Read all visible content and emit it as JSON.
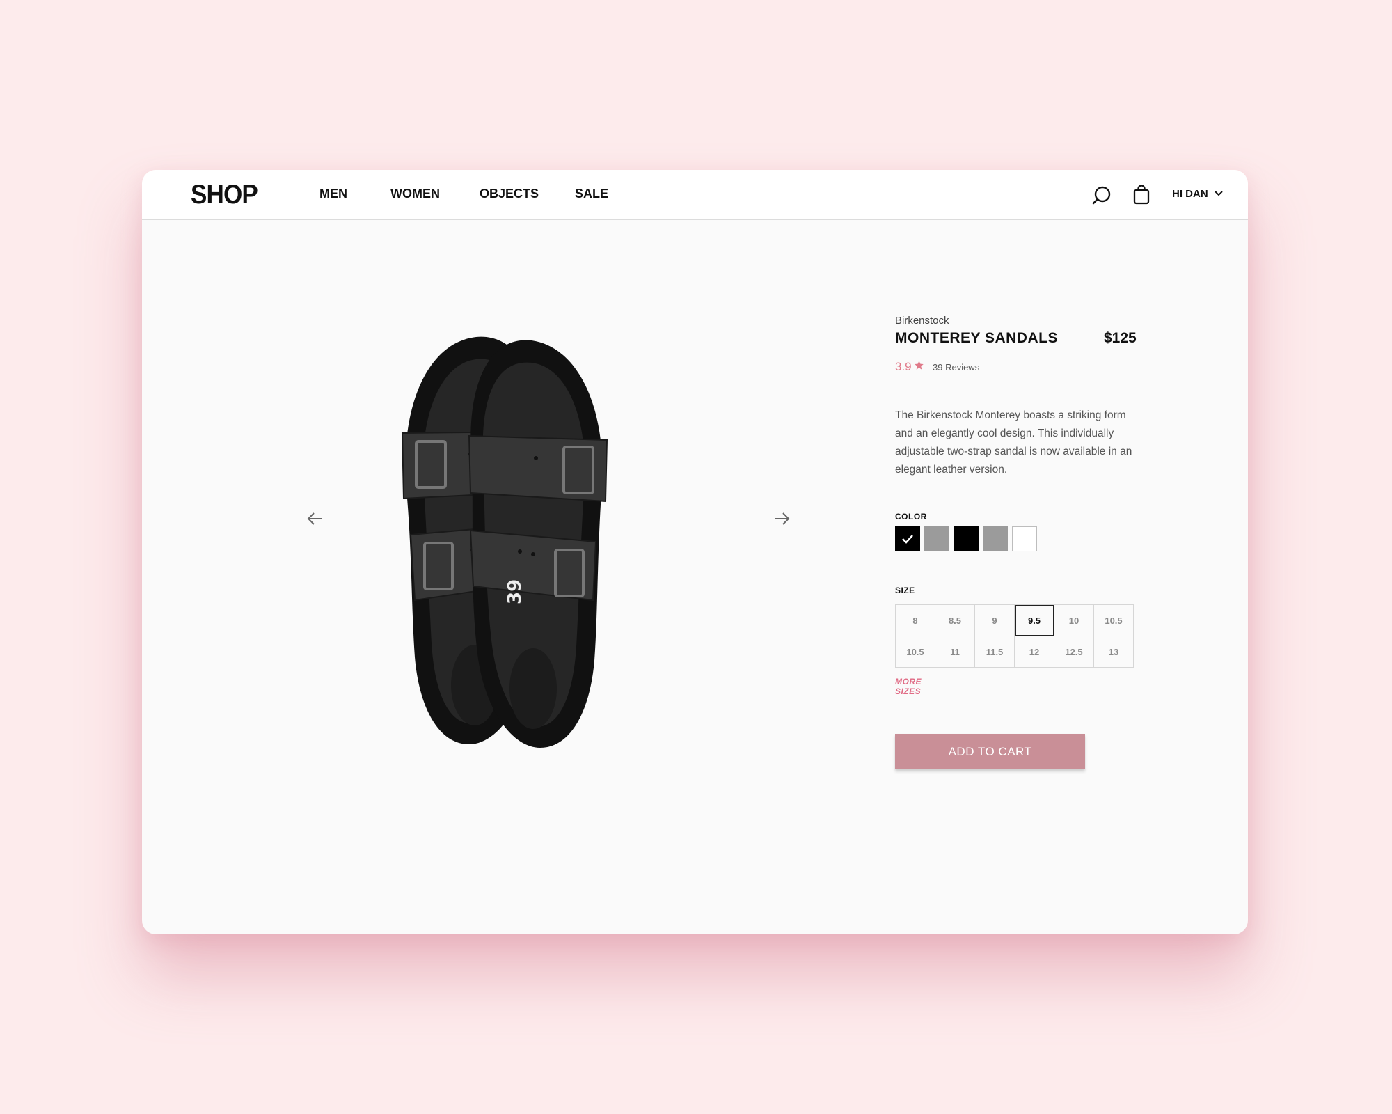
{
  "app": {
    "logo": "SHOP"
  },
  "nav": {
    "items": [
      {
        "label": "MEN"
      },
      {
        "label": "WOMEN"
      },
      {
        "label": "OBJECTS"
      },
      {
        "label": "SALE"
      }
    ]
  },
  "header": {
    "user_greeting": "HI DAN",
    "icons": [
      "search-icon",
      "shopping-bag-icon",
      "chevron-down-icon"
    ]
  },
  "gallery": {
    "icons": [
      "arrow-left-icon",
      "arrow-right-icon"
    ]
  },
  "product": {
    "brand": "Birkenstock",
    "name": "MONTEREY SANDALS",
    "price": "$125",
    "rating": "3.9",
    "reviews": "39 Reviews",
    "description": "The Birkenstock Monterey boasts a striking form and an elegantly cool design. This individually adjustable two-strap sandal is now available in an elegant leather version."
  },
  "color": {
    "label": "COLOR",
    "swatches": [
      {
        "hex": "#000000",
        "selected": true
      },
      {
        "hex": "#9b9b9b",
        "selected": false
      },
      {
        "hex": "#000000",
        "selected": false
      },
      {
        "hex": "#9b9b9b",
        "selected": false
      },
      {
        "hex": "#ffffff",
        "selected": false
      }
    ]
  },
  "size": {
    "label": "SIZE",
    "options": [
      "8",
      "8.5",
      "9",
      "9.5",
      "10",
      "10.5",
      "10.5",
      "11",
      "11.5",
      "12",
      "12.5",
      "13"
    ],
    "selected": "9.5",
    "more_label": "MORE SIZES"
  },
  "cart": {
    "add_label": "ADD TO CART"
  },
  "colors": {
    "accent": "#e07a8a",
    "button": "#c98f97",
    "page_bg": "#fdebec"
  }
}
